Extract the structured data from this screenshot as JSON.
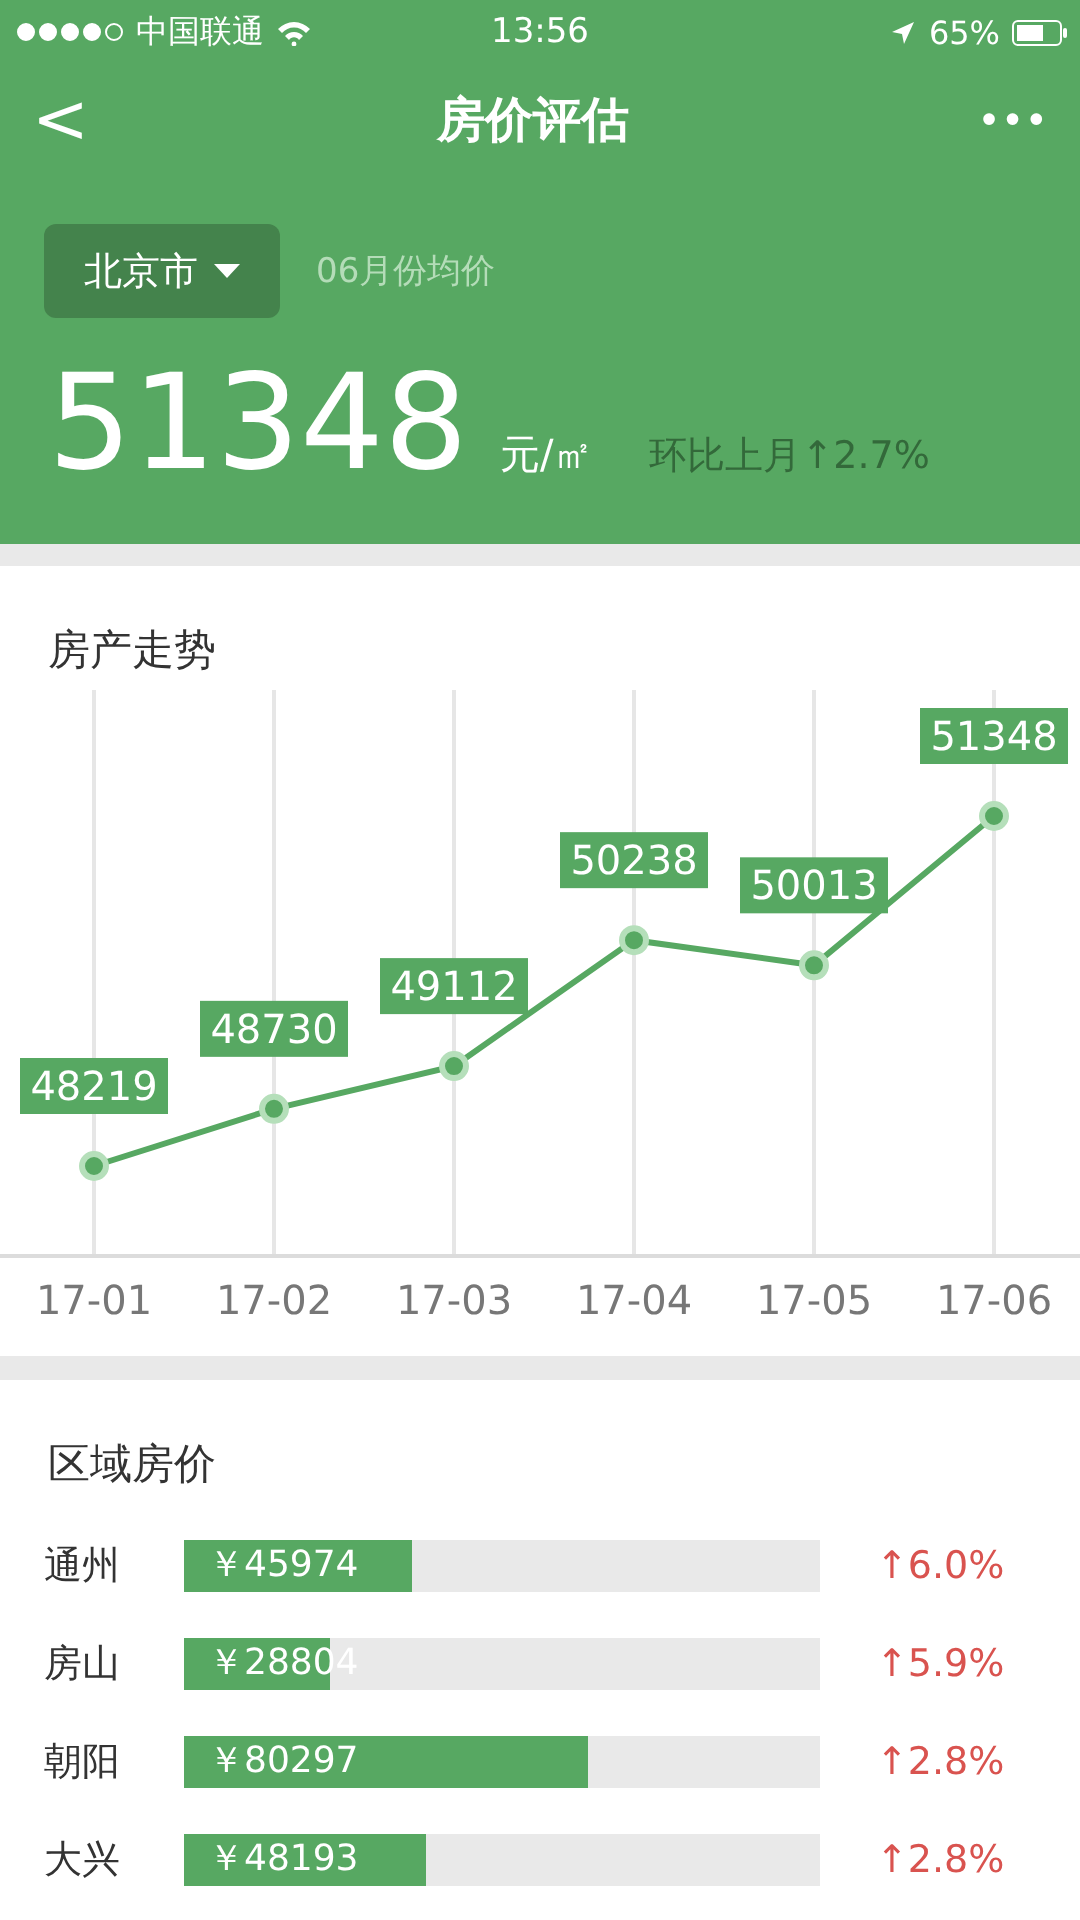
{
  "status_bar": {
    "carrier": "中国联通",
    "time": "13:56",
    "battery": "65%"
  },
  "nav": {
    "back": "<",
    "title": "房价评估",
    "more": "•••"
  },
  "summary": {
    "city": "北京市",
    "period": "06月份均价",
    "price": "51348",
    "unit": "元/㎡",
    "change_label": "环比上月",
    "change": "↑2.7%"
  },
  "trend": {
    "title": "房产走势",
    "chart_data": {
      "type": "line",
      "categories": [
        "17-01",
        "17-02",
        "17-03",
        "17-04",
        "17-05",
        "17-06"
      ],
      "series": [
        {
          "color": "#57a862",
          "marker": true,
          "values": [
            48219,
            48730,
            49112,
            50238,
            50013,
            51348
          ]
        }
      ],
      "grid": true,
      "data_labels": true
    }
  },
  "regions": {
    "title": "区域房价",
    "items": [
      {
        "name": "通州",
        "price": "￥45974",
        "level": 0.36,
        "change": "↑6.0%"
      },
      {
        "name": "房山",
        "price": "￥28804",
        "level": 0.23,
        "change": "↑5.9%"
      },
      {
        "name": "朝阳",
        "price": "￥80297",
        "level": 0.635,
        "change": "↑2.8%"
      },
      {
        "name": "大兴",
        "price": "￥48193",
        "level": 0.38,
        "change": "↑2.8%"
      }
    ]
  }
}
